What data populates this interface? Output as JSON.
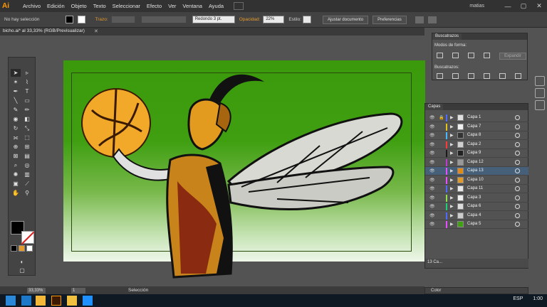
{
  "app": {
    "logo": "Ai",
    "user": "matias"
  },
  "menu": [
    "Archivo",
    "Edición",
    "Objeto",
    "Texto",
    "Seleccionar",
    "Efecto",
    "Ver",
    "Ventana",
    "Ayuda"
  ],
  "window_controls": [
    "—",
    "▢",
    "✕"
  ],
  "control_bar": {
    "selection_status": "No hay selección",
    "stroke_label": "Trazo:",
    "brush_value": "Redondo 3 pt.",
    "opacity_label": "Opacidad:",
    "opacity_value": "22%",
    "style_label": "Estilo:",
    "adjust_button": "Ajustar documento",
    "prefs_button": "Preferencias"
  },
  "document": {
    "tab_title": "bicho.ai* al 33,33% (RGB/Previsualizar)",
    "close": "✕"
  },
  "status": {
    "zoom": "33,33%",
    "page": "1",
    "tool_status": "Selección"
  },
  "pathfinder": {
    "tab": "Buscatrazos",
    "shape_modes_label": "Modos de forma:",
    "pathfinders_label": "Buscatrazos:",
    "expand_button": "Expandir"
  },
  "layers": {
    "tab": "Capas",
    "count": "13 Ca...",
    "items": [
      {
        "name": "Capa 1",
        "color": "#4f6bff",
        "locked": true,
        "thumb": "#e0e0e0"
      },
      {
        "name": "Capa 7",
        "color": "#e6c21a",
        "locked": false,
        "thumb": "#f0f0f0"
      },
      {
        "name": "Capa 8",
        "color": "#49b8ff",
        "locked": false,
        "thumb": "#333"
      },
      {
        "name": "Capa 2",
        "color": "#ff3a3a",
        "locked": false,
        "thumb": "#d0d0d0"
      },
      {
        "name": "Capa 9",
        "color": "#1a1a1a",
        "locked": false,
        "thumb": "#222"
      },
      {
        "name": "Capa 12",
        "color": "#c23ad4",
        "locked": false,
        "thumb": "#999"
      },
      {
        "name": "Capa 13",
        "color": "#e84dff",
        "locked": false,
        "thumb": "#e08a1a",
        "selected": true
      },
      {
        "name": "Capa 10",
        "color": "#e84dff",
        "locked": false,
        "thumb": "#e09a2a"
      },
      {
        "name": "Capa 11",
        "color": "#4f6bff",
        "locked": false,
        "thumb": "#e8e8e8"
      },
      {
        "name": "Capa 3",
        "color": "#8fe04a",
        "locked": false,
        "thumb": "#eee"
      },
      {
        "name": "Capa 6",
        "color": "#1fd07a",
        "locked": false,
        "thumb": "#ddd"
      },
      {
        "name": "Capa 4",
        "color": "#4f6bff",
        "locked": false,
        "thumb": "#ccc"
      },
      {
        "name": "Capa 5",
        "color": "#e84dff",
        "locked": false,
        "thumb": "#3fa010"
      }
    ]
  },
  "color_panel": {
    "tab": "Color"
  },
  "taskbar": {
    "lang": "ESP",
    "time": "1:00"
  }
}
